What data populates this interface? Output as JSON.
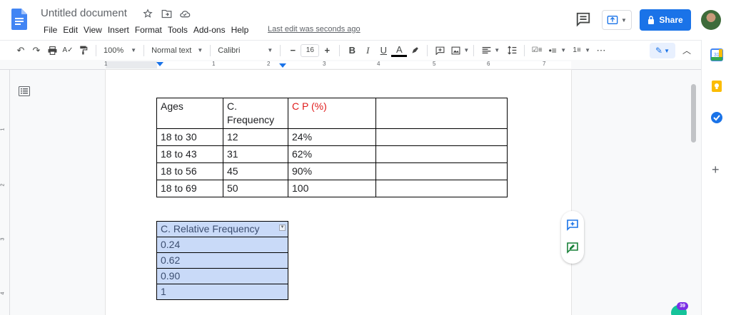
{
  "header": {
    "title": "Untitled document",
    "menu": [
      "File",
      "Edit",
      "View",
      "Insert",
      "Format",
      "Tools",
      "Add-ons",
      "Help"
    ],
    "last_edit": "Last edit was seconds ago",
    "share_label": "Share"
  },
  "toolbar": {
    "zoom": "100%",
    "style": "Normal text",
    "font": "Calibri",
    "font_size": "16"
  },
  "ruler": {
    "numbers": [
      "1",
      "1",
      "2",
      "3",
      "4",
      "5",
      "6",
      "7"
    ]
  },
  "vruler": {
    "numbers": [
      "1",
      "2",
      "3",
      "4"
    ]
  },
  "table1": {
    "headers": [
      "Ages",
      "C.\nFrequency",
      "C P (%)",
      ""
    ],
    "rows": [
      [
        "18 to 30",
        "12",
        "24%",
        ""
      ],
      [
        "18 to 43",
        "31",
        "62%",
        ""
      ],
      [
        "18 to 56",
        "45",
        "90%",
        ""
      ],
      [
        "18 to 69",
        "50",
        "100",
        ""
      ]
    ]
  },
  "table2": {
    "header": "C. Relative Frequency",
    "rows": [
      "0.24",
      "0.62",
      "0.90",
      "1"
    ]
  },
  "grammarly": {
    "badge": "39"
  },
  "colors": {
    "accent": "#1a73e8",
    "red_text": "#e01b1b",
    "selection": "#c9daf8"
  }
}
